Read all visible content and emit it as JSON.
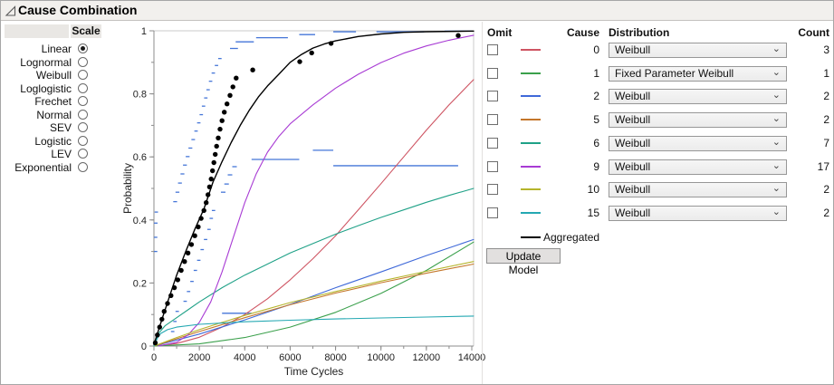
{
  "window": {
    "title": "Cause Combination"
  },
  "scale_panel": {
    "header": "Scale",
    "options": [
      {
        "label": "Linear",
        "selected": true
      },
      {
        "label": "Lognormal",
        "selected": false
      },
      {
        "label": "Weibull",
        "selected": false
      },
      {
        "label": "Loglogistic",
        "selected": false
      },
      {
        "label": "Frechet",
        "selected": false
      },
      {
        "label": "Normal",
        "selected": false
      },
      {
        "label": "SEV",
        "selected": false
      },
      {
        "label": "Logistic",
        "selected": false
      },
      {
        "label": "LEV",
        "selected": false
      },
      {
        "label": "Exponential",
        "selected": false
      }
    ]
  },
  "causes_table": {
    "columns": {
      "omit": "Omit",
      "cause": "Cause",
      "distribution": "Distribution",
      "count": "Count"
    },
    "rows": [
      {
        "cause": "0",
        "color": "#CE5462",
        "distribution": "Weibull",
        "count": "3",
        "omitted": false
      },
      {
        "cause": "1",
        "color": "#3BA04C",
        "distribution": "Fixed Parameter Weibull",
        "count": "1",
        "omitted": false
      },
      {
        "cause": "2",
        "color": "#3F69D9",
        "distribution": "Weibull",
        "count": "2",
        "omitted": false
      },
      {
        "cause": "5",
        "color": "#C4762A",
        "distribution": "Weibull",
        "count": "2",
        "omitted": false
      },
      {
        "cause": "6",
        "color": "#1FA187",
        "distribution": "Weibull",
        "count": "7",
        "omitted": false
      },
      {
        "cause": "9",
        "color": "#A83BD4",
        "distribution": "Weibull",
        "count": "17",
        "omitted": false
      },
      {
        "cause": "10",
        "color": "#B5B42B",
        "distribution": "Weibull",
        "count": "2",
        "omitted": false
      },
      {
        "cause": "15",
        "color": "#24A8B2",
        "distribution": "Weibull",
        "count": "2",
        "omitted": false
      }
    ],
    "aggregated_label": "Aggregated",
    "aggregated_color": "#000000",
    "update_button": "Update Model"
  },
  "chart_data": {
    "type": "line",
    "xlabel": "Time Cycles",
    "ylabel": "Probability",
    "xlim": [
      0,
      14080
    ],
    "ylim": [
      0,
      1
    ],
    "xticks": [
      [
        0,
        "0"
      ],
      [
        2000,
        "2000"
      ],
      [
        4000,
        "4000"
      ],
      [
        6000,
        "6000"
      ],
      [
        8000,
        "8000"
      ],
      [
        10000,
        "10000"
      ],
      [
        12000,
        "12000"
      ],
      [
        14000,
        "14000"
      ]
    ],
    "yticks": [
      [
        0,
        "0"
      ],
      [
        0.2,
        "0.2"
      ],
      [
        0.4,
        "0.4"
      ],
      [
        0.6,
        "0.6"
      ],
      [
        0.8,
        "0.8"
      ],
      [
        1,
        "1"
      ]
    ],
    "x_minor_step": 1000,
    "y_minor_step": 0.1,
    "ci_color": "#4576D8",
    "series": [
      {
        "name": "cause-0",
        "color": "#CE5462",
        "points": [
          [
            0,
            0
          ],
          [
            1000,
            0.008
          ],
          [
            2000,
            0.028
          ],
          [
            3000,
            0.06
          ],
          [
            4000,
            0.1
          ],
          [
            5000,
            0.15
          ],
          [
            6000,
            0.21
          ],
          [
            7000,
            0.277
          ],
          [
            8000,
            0.35
          ],
          [
            9000,
            0.432
          ],
          [
            10000,
            0.515
          ],
          [
            11000,
            0.6
          ],
          [
            12000,
            0.685
          ],
          [
            13000,
            0.765
          ],
          [
            14080,
            0.845
          ]
        ]
      },
      {
        "name": "cause-1",
        "color": "#3BA04C",
        "points": [
          [
            0,
            0
          ],
          [
            2000,
            0.007
          ],
          [
            4000,
            0.027
          ],
          [
            6000,
            0.06
          ],
          [
            8000,
            0.107
          ],
          [
            10000,
            0.167
          ],
          [
            12000,
            0.24
          ],
          [
            14080,
            0.33
          ]
        ]
      },
      {
        "name": "cause-2",
        "color": "#3F69D9",
        "points": [
          [
            0,
            0
          ],
          [
            2000,
            0.038
          ],
          [
            4000,
            0.083
          ],
          [
            6000,
            0.132
          ],
          [
            8000,
            0.185
          ],
          [
            10000,
            0.235
          ],
          [
            12000,
            0.287
          ],
          [
            14080,
            0.338
          ]
        ]
      },
      {
        "name": "cause-5",
        "color": "#C4762A",
        "points": [
          [
            0,
            0
          ],
          [
            2000,
            0.046
          ],
          [
            4000,
            0.09
          ],
          [
            6000,
            0.131
          ],
          [
            8000,
            0.168
          ],
          [
            10000,
            0.201
          ],
          [
            12000,
            0.231
          ],
          [
            14080,
            0.26
          ]
        ]
      },
      {
        "name": "cause-6",
        "color": "#1FA187",
        "points": [
          [
            0,
            0
          ],
          [
            200,
            0.04
          ],
          [
            500,
            0.065
          ],
          [
            1000,
            0.09
          ],
          [
            1500,
            0.115
          ],
          [
            2000,
            0.14
          ],
          [
            3000,
            0.185
          ],
          [
            4000,
            0.225
          ],
          [
            5000,
            0.26
          ],
          [
            6000,
            0.295
          ],
          [
            7000,
            0.325
          ],
          [
            8000,
            0.355
          ],
          [
            9000,
            0.382
          ],
          [
            10000,
            0.408
          ],
          [
            11000,
            0.432
          ],
          [
            12000,
            0.456
          ],
          [
            13000,
            0.478
          ],
          [
            14080,
            0.5
          ]
        ]
      },
      {
        "name": "cause-9",
        "color": "#A83BD4",
        "points": [
          [
            200,
            0
          ],
          [
            1000,
            0.012
          ],
          [
            1500,
            0.035
          ],
          [
            2000,
            0.075
          ],
          [
            2500,
            0.14
          ],
          [
            3000,
            0.235
          ],
          [
            3500,
            0.345
          ],
          [
            4000,
            0.455
          ],
          [
            4500,
            0.545
          ],
          [
            5000,
            0.615
          ],
          [
            5500,
            0.665
          ],
          [
            6000,
            0.705
          ],
          [
            7000,
            0.765
          ],
          [
            8000,
            0.818
          ],
          [
            9000,
            0.862
          ],
          [
            10000,
            0.899
          ],
          [
            11000,
            0.929
          ],
          [
            12000,
            0.952
          ],
          [
            13000,
            0.97
          ],
          [
            14080,
            0.986
          ]
        ]
      },
      {
        "name": "cause-10",
        "color": "#B5B42B",
        "points": [
          [
            0,
            0
          ],
          [
            1000,
            0.027
          ],
          [
            2000,
            0.052
          ],
          [
            3000,
            0.075
          ],
          [
            4000,
            0.097
          ],
          [
            6000,
            0.138
          ],
          [
            8000,
            0.173
          ],
          [
            10000,
            0.206
          ],
          [
            12000,
            0.237
          ],
          [
            14080,
            0.268
          ]
        ]
      },
      {
        "name": "cause-15",
        "color": "#24A8B2",
        "points": [
          [
            0,
            0
          ],
          [
            150,
            0.025
          ],
          [
            300,
            0.04
          ],
          [
            600,
            0.052
          ],
          [
            1000,
            0.06
          ],
          [
            2000,
            0.069
          ],
          [
            4000,
            0.077
          ],
          [
            6000,
            0.082
          ],
          [
            8000,
            0.086
          ],
          [
            10000,
            0.089
          ],
          [
            12000,
            0.092
          ],
          [
            14080,
            0.095
          ]
        ]
      },
      {
        "name": "aggregated",
        "color": "#000000",
        "points": [
          [
            0,
            0.005
          ],
          [
            200,
            0.05
          ],
          [
            400,
            0.095
          ],
          [
            700,
            0.16
          ],
          [
            1000,
            0.225
          ],
          [
            1400,
            0.3
          ],
          [
            1800,
            0.37
          ],
          [
            2200,
            0.435
          ],
          [
            2600,
            0.52
          ],
          [
            3000,
            0.585
          ],
          [
            3400,
            0.645
          ],
          [
            3800,
            0.7
          ],
          [
            4200,
            0.748
          ],
          [
            4600,
            0.79
          ],
          [
            5000,
            0.825
          ],
          [
            5500,
            0.862
          ],
          [
            6000,
            0.9
          ],
          [
            6500,
            0.925
          ],
          [
            7000,
            0.945
          ],
          [
            7500,
            0.958
          ],
          [
            8000,
            0.968
          ],
          [
            9000,
            0.982
          ],
          [
            10000,
            0.99
          ],
          [
            11000,
            0.995
          ],
          [
            12000,
            0.997
          ],
          [
            14080,
            0.999
          ]
        ]
      }
    ],
    "scatter": {
      "name": "nonparametric-estimate",
      "color": "#000000",
      "points": [
        [
          60,
          0.01
        ],
        [
          150,
          0.035
        ],
        [
          250,
          0.06
        ],
        [
          350,
          0.085
        ],
        [
          450,
          0.11
        ],
        [
          600,
          0.135
        ],
        [
          750,
          0.16
        ],
        [
          900,
          0.185
        ],
        [
          1050,
          0.21
        ],
        [
          1200,
          0.24
        ],
        [
          1350,
          0.268
        ],
        [
          1500,
          0.295
        ],
        [
          1650,
          0.322
        ],
        [
          1800,
          0.35
        ],
        [
          1950,
          0.378
        ],
        [
          2080,
          0.405
        ],
        [
          2200,
          0.43
        ],
        [
          2300,
          0.455
        ],
        [
          2380,
          0.48
        ],
        [
          2450,
          0.505
        ],
        [
          2520,
          0.53
        ],
        [
          2580,
          0.556
        ],
        [
          2640,
          0.582
        ],
        [
          2700,
          0.608
        ],
        [
          2760,
          0.634
        ],
        [
          2830,
          0.66
        ],
        [
          2910,
          0.688
        ],
        [
          3000,
          0.715
        ],
        [
          3100,
          0.742
        ],
        [
          3220,
          0.768
        ],
        [
          3350,
          0.795
        ],
        [
          3480,
          0.822
        ],
        [
          3620,
          0.85
        ],
        [
          4350,
          0.876
        ],
        [
          6420,
          0.902
        ],
        [
          6950,
          0.93
        ],
        [
          7800,
          0.96
        ],
        [
          13400,
          0.985
        ]
      ]
    },
    "ci_segments": [
      [
        0,
        150,
        0.3
      ],
      [
        0,
        150,
        0.345
      ],
      [
        0,
        160,
        0.39
      ],
      [
        30,
        180,
        0.425
      ],
      [
        850,
        1020,
        0.458
      ],
      [
        950,
        1120,
        0.488
      ],
      [
        1060,
        1230,
        0.517
      ],
      [
        1170,
        1340,
        0.546
      ],
      [
        1280,
        1450,
        0.574
      ],
      [
        1400,
        1570,
        0.601
      ],
      [
        1520,
        1690,
        0.628
      ],
      [
        1650,
        1810,
        0.655
      ],
      [
        1780,
        1930,
        0.682
      ],
      [
        1900,
        2050,
        0.708
      ],
      [
        2010,
        2160,
        0.734
      ],
      [
        2110,
        2260,
        0.761
      ],
      [
        2210,
        2360,
        0.787
      ],
      [
        2310,
        2460,
        0.813
      ],
      [
        2420,
        2570,
        0.84
      ],
      [
        2540,
        2690,
        0.866
      ],
      [
        2680,
        2830,
        0.89
      ],
      [
        2830,
        2980,
        0.912
      ],
      [
        3350,
        3700,
        0.944
      ],
      [
        3600,
        4400,
        0.965
      ],
      [
        4500,
        5900,
        0.978
      ],
      [
        6400,
        7100,
        0.988
      ],
      [
        7900,
        8900,
        0.997
      ],
      [
        9800,
        11900,
        0.997
      ],
      [
        12800,
        14000,
        0.999
      ],
      [
        750,
        900,
        0.046
      ],
      [
        850,
        1000,
        0.078
      ],
      [
        950,
        1100,
        0.11
      ],
      [
        1300,
        1450,
        0.142
      ],
      [
        1450,
        1600,
        0.173
      ],
      [
        1600,
        1750,
        0.205
      ],
      [
        1750,
        1900,
        0.24
      ],
      [
        1900,
        2050,
        0.272
      ],
      [
        2050,
        2200,
        0.306
      ],
      [
        2200,
        2350,
        0.338
      ],
      [
        2350,
        2500,
        0.37
      ],
      [
        2450,
        2600,
        0.405
      ],
      [
        2550,
        2700,
        0.43
      ],
      [
        3000,
        4300,
        0.104
      ],
      [
        2950,
        3150,
        0.488
      ],
      [
        3100,
        3300,
        0.514
      ],
      [
        3250,
        3450,
        0.543
      ],
      [
        3450,
        3650,
        0.569
      ],
      [
        4300,
        6400,
        0.592
      ],
      [
        7000,
        7900,
        0.621
      ],
      [
        7900,
        13400,
        0.572
      ]
    ]
  }
}
